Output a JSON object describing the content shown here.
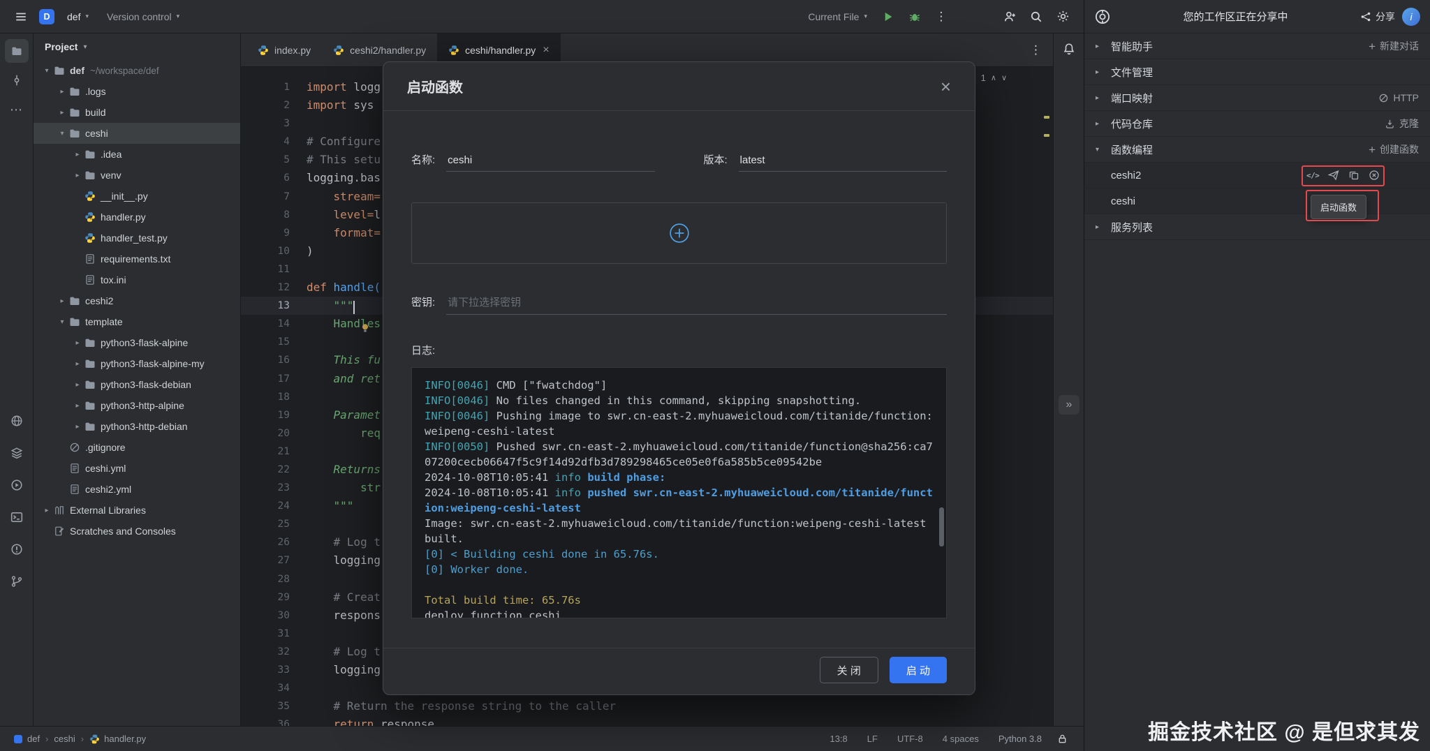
{
  "toolbar": {
    "project_badge": "D",
    "project_name": "def",
    "vcs_label": "Version control",
    "run_config_label": "Current File"
  },
  "activity_bar": {
    "top": [
      "folder",
      "commit",
      "more"
    ],
    "bottom": [
      "web",
      "services",
      "run-circle",
      "terminal",
      "problems",
      "branch"
    ]
  },
  "project_panel": {
    "title": "Project",
    "items": [
      {
        "label": "def",
        "hint": "~/workspace/def",
        "depth": 0,
        "chevron": "down",
        "icon": "folder",
        "bold": true
      },
      {
        "label": ".logs",
        "depth": 1,
        "chevron": "right",
        "icon": "folder"
      },
      {
        "label": "build",
        "depth": 1,
        "chevron": "right",
        "icon": "folder"
      },
      {
        "label": "ceshi",
        "depth": 1,
        "chevron": "down",
        "icon": "folder",
        "selected": true
      },
      {
        "label": ".idea",
        "depth": 2,
        "chevron": "right",
        "icon": "folder"
      },
      {
        "label": "venv",
        "depth": 2,
        "chevron": "right",
        "icon": "folder"
      },
      {
        "label": "__init__.py",
        "depth": 2,
        "icon": "python"
      },
      {
        "label": "handler.py",
        "depth": 2,
        "icon": "python"
      },
      {
        "label": "handler_test.py",
        "depth": 2,
        "icon": "python"
      },
      {
        "label": "requirements.txt",
        "depth": 2,
        "icon": "file-text"
      },
      {
        "label": "tox.ini",
        "depth": 2,
        "icon": "file-text"
      },
      {
        "label": "ceshi2",
        "depth": 1,
        "chevron": "right",
        "icon": "folder"
      },
      {
        "label": "template",
        "depth": 1,
        "chevron": "down",
        "icon": "folder"
      },
      {
        "label": "python3-flask-alpine",
        "depth": 2,
        "chevron": "right",
        "icon": "folder"
      },
      {
        "label": "python3-flask-alpine-my",
        "depth": 2,
        "chevron": "right",
        "icon": "folder"
      },
      {
        "label": "python3-flask-debian",
        "depth": 2,
        "chevron": "right",
        "icon": "folder"
      },
      {
        "label": "python3-http-alpine",
        "depth": 2,
        "chevron": "right",
        "icon": "folder"
      },
      {
        "label": "python3-http-debian",
        "depth": 2,
        "chevron": "right",
        "icon": "folder"
      },
      {
        "label": ".gitignore",
        "depth": 1,
        "icon": "gitignore"
      },
      {
        "label": "ceshi.yml",
        "depth": 1,
        "icon": "yaml"
      },
      {
        "label": "ceshi2.yml",
        "depth": 1,
        "icon": "yaml"
      },
      {
        "label": "External Libraries",
        "depth": 0,
        "chevron": "right",
        "icon": "library"
      },
      {
        "label": "Scratches and Consoles",
        "depth": 0,
        "icon": "scratches"
      }
    ]
  },
  "tabs": {
    "items": [
      {
        "label": "index.py",
        "icon": "python"
      },
      {
        "label": "ceshi2/handler.py",
        "icon": "python"
      },
      {
        "label": "ceshi/handler.py",
        "icon": "python",
        "active": true,
        "closable": true
      }
    ]
  },
  "editor": {
    "inspection_count": "1",
    "lines": [
      {
        "n": 1,
        "seg": [
          [
            "kw",
            "import"
          ],
          [
            "pl",
            " logg"
          ]
        ]
      },
      {
        "n": 2,
        "seg": [
          [
            "kw",
            "import"
          ],
          [
            "pl",
            " sys"
          ]
        ]
      },
      {
        "n": 3,
        "seg": []
      },
      {
        "n": 4,
        "seg": [
          [
            "com",
            "# Configure"
          ]
        ]
      },
      {
        "n": 5,
        "seg": [
          [
            "com",
            "# This setu"
          ]
        ]
      },
      {
        "n": 6,
        "seg": [
          [
            "pl",
            "logging.bas"
          ]
        ]
      },
      {
        "n": 7,
        "seg": [
          [
            "pl",
            "    "
          ],
          [
            "arg",
            "stream="
          ]
        ]
      },
      {
        "n": 8,
        "seg": [
          [
            "pl",
            "    "
          ],
          [
            "arg",
            "level="
          ],
          [
            "pl",
            "l"
          ]
        ]
      },
      {
        "n": 9,
        "seg": [
          [
            "pl",
            "    "
          ],
          [
            "arg",
            "format="
          ]
        ]
      },
      {
        "n": 10,
        "seg": [
          [
            "pl",
            ")"
          ]
        ]
      },
      {
        "n": 11,
        "seg": []
      },
      {
        "n": 12,
        "seg": [
          [
            "kw",
            "def "
          ],
          [
            "fn",
            "handle("
          ]
        ]
      },
      {
        "n": 13,
        "seg": [
          [
            "str",
            "    \"\"\""
          ]
        ],
        "current": true
      },
      {
        "n": 14,
        "seg": [
          [
            "str",
            "    Handles"
          ]
        ]
      },
      {
        "n": 15,
        "seg": []
      },
      {
        "n": 16,
        "seg": [
          [
            "stri",
            "    This fu"
          ]
        ]
      },
      {
        "n": 17,
        "seg": [
          [
            "stri",
            "    and ret"
          ]
        ]
      },
      {
        "n": 18,
        "seg": []
      },
      {
        "n": 19,
        "seg": [
          [
            "stri",
            "    Paramet"
          ]
        ]
      },
      {
        "n": 20,
        "seg": [
          [
            "str",
            "        req"
          ]
        ]
      },
      {
        "n": 21,
        "seg": []
      },
      {
        "n": 22,
        "seg": [
          [
            "stri",
            "    Returns"
          ]
        ]
      },
      {
        "n": 23,
        "seg": [
          [
            "str",
            "        str"
          ]
        ]
      },
      {
        "n": 24,
        "seg": [
          [
            "str",
            "    \"\"\""
          ]
        ]
      },
      {
        "n": 25,
        "seg": []
      },
      {
        "n": 26,
        "seg": [
          [
            "com",
            "    # Log t"
          ]
        ]
      },
      {
        "n": 27,
        "seg": [
          [
            "pl",
            "    logging"
          ]
        ]
      },
      {
        "n": 28,
        "seg": []
      },
      {
        "n": 29,
        "seg": [
          [
            "com",
            "    # Creat"
          ]
        ]
      },
      {
        "n": 30,
        "seg": [
          [
            "pl",
            "    respons"
          ]
        ]
      },
      {
        "n": 31,
        "seg": []
      },
      {
        "n": 32,
        "seg": [
          [
            "com",
            "    # Log t"
          ]
        ]
      },
      {
        "n": 33,
        "seg": [
          [
            "pl",
            "    logging"
          ]
        ]
      },
      {
        "n": 34,
        "seg": []
      },
      {
        "n": 35,
        "seg": [
          [
            "com",
            "    # Return the response string to the caller"
          ]
        ]
      },
      {
        "n": 36,
        "seg": [
          [
            "kw",
            "    return"
          ],
          [
            "pl",
            " response"
          ]
        ]
      }
    ]
  },
  "modal": {
    "title": "启动函数",
    "fields": {
      "name_label": "名称:",
      "name_value": "ceshi",
      "version_label": "版本:",
      "version_value": "latest",
      "secret_label": "密钥:",
      "secret_placeholder": "请下拉选择密钥",
      "log_label": "日志:"
    },
    "log_lines": [
      {
        "seg": [
          [
            "info",
            "INFO[0046]"
          ],
          [
            "pl",
            " CMD [\"fwatchdog\"]"
          ]
        ]
      },
      {
        "seg": [
          [
            "info",
            "INFO[0046]"
          ],
          [
            "pl",
            " No files changed in this command, skipping snapshotting."
          ]
        ]
      },
      {
        "seg": [
          [
            "info",
            "INFO[0046]"
          ],
          [
            "pl",
            " Pushing image to swr.cn-east-2.myhuaweicloud.com/titanide/function:weipeng-ceshi-latest"
          ]
        ]
      },
      {
        "seg": [
          [
            "info",
            "INFO[0050]"
          ],
          [
            "pl",
            " Pushed swr.cn-east-2.myhuaweicloud.com/titanide/function@sha256:ca707200cecb06647f5c9f14d92dfb3d789298465ce05e0f6a585b5ce09542be"
          ]
        ]
      },
      {
        "seg": [
          [
            "pl",
            "2024-10-08T10:05:41 "
          ],
          [
            "info",
            "info "
          ],
          [
            "url",
            "build phase:"
          ]
        ]
      },
      {
        "seg": [
          [
            "pl",
            "2024-10-08T10:05:41 "
          ],
          [
            "info",
            "info "
          ],
          [
            "url",
            "pushed swr.cn-east-2.myhuaweicloud.com/titanide/function:weipeng-ceshi-latest"
          ]
        ]
      },
      {
        "seg": [
          [
            "pl",
            "Image: swr.cn-east-2.myhuaweicloud.com/titanide/function:weipeng-ceshi-latest built."
          ]
        ]
      },
      {
        "seg": [
          [
            "ok",
            "[0] < Building ceshi done in 65.76s."
          ]
        ]
      },
      {
        "seg": [
          [
            "ok",
            "[0] Worker done."
          ]
        ]
      },
      {
        "seg": []
      },
      {
        "seg": [
          [
            "warn",
            "Total build time: 65.76s"
          ]
        ]
      },
      {
        "seg": [
          [
            "pl",
            "deploy function ceshi"
          ]
        ]
      }
    ],
    "buttons": {
      "close": "关 闭",
      "start": "启 动"
    }
  },
  "right_panel": {
    "header": {
      "title": "您的工作区正在分享中",
      "share_label": "分享",
      "avatar_text": "i"
    },
    "sections": [
      {
        "key": "ai-assistant",
        "label": "智能助手",
        "chevron": "right",
        "action_label": "新建对话",
        "action_icon": "plus",
        "action_name": "new-chat-button"
      },
      {
        "key": "file-manager",
        "label": "文件管理",
        "chevron": "right"
      },
      {
        "key": "port-mapping",
        "label": "端口映射",
        "chevron": "right",
        "action_label": "HTTP",
        "action_icon": "http",
        "action_name": "http-button"
      },
      {
        "key": "code-repository",
        "label": "代码仓库",
        "chevron": "right",
        "action_label": "克隆",
        "action_icon": "clone",
        "action_name": "clone-button"
      },
      {
        "key": "function-programming",
        "label": "函数编程",
        "chevron": "down",
        "action_label": "创建函数",
        "action_icon": "plus",
        "action_name": "create-function-button"
      }
    ],
    "functions": [
      {
        "name": "ceshi2",
        "icons": [
          "code",
          "deploy",
          "copy",
          "close-circle"
        ]
      },
      {
        "name": "ceshi",
        "icons": []
      }
    ],
    "service_section": {
      "label": "服务列表"
    },
    "tooltip": "启动函数",
    "annotation_color": "#e5484d",
    "watermark": "掘金技术社区 @ 是但求其发"
  },
  "status_bar": {
    "breadcrumbs": [
      {
        "label": "def",
        "icon": "project-square"
      },
      {
        "label": "ceshi"
      },
      {
        "label": "handler.py",
        "icon": "python"
      }
    ],
    "items": [
      "13:8",
      "LF",
      "UTF-8",
      "4 spaces",
      "Python 3.8"
    ]
  }
}
